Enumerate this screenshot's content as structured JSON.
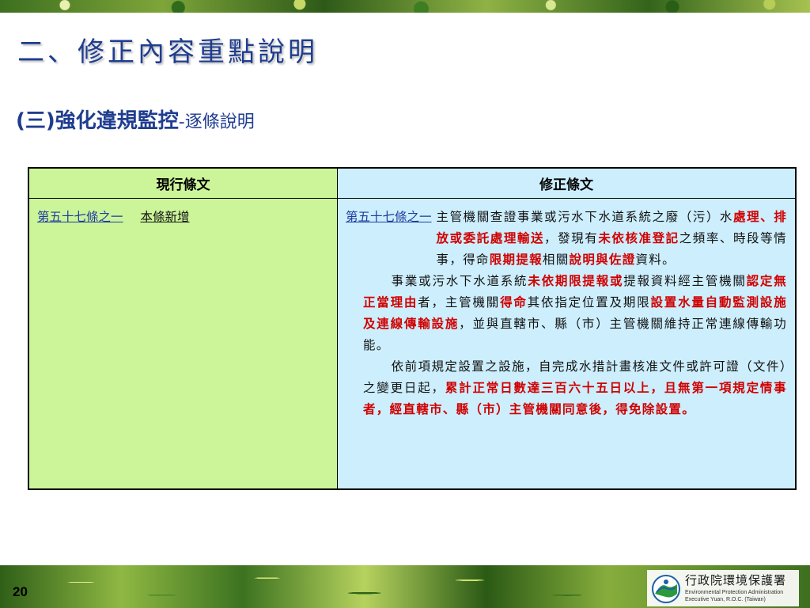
{
  "title": "二、修正內容重點說明",
  "subtitle": {
    "main": "(三)強化違規監控",
    "sub": "-逐條說明"
  },
  "table": {
    "headers": [
      "現行條文",
      "修正條文"
    ],
    "current": {
      "article": "第五十七條之一",
      "note": "本條新增"
    },
    "revised": {
      "article": "第五十七條之一",
      "p1": [
        {
          "t": "主管機關查證事業或污水下水道系統之廢（污）水",
          "b": false
        },
        {
          "t": "處理、排放或委託處理輸送",
          "b": true
        },
        {
          "t": "，發現有",
          "b": false
        },
        {
          "t": "未依核准登記",
          "b": true
        },
        {
          "t": "之頻率、時段等情事，得命",
          "b": false
        },
        {
          "t": "限期提報",
          "b": true
        },
        {
          "t": "相關",
          "b": false
        },
        {
          "t": "說明與佐證",
          "b": true
        },
        {
          "t": "資料。",
          "b": false
        }
      ],
      "p2": [
        {
          "t": "事業或污水下水道系統",
          "b": false
        },
        {
          "t": "未依期限提報或",
          "b": true
        },
        {
          "t": "提報資料經主管機關",
          "b": false
        },
        {
          "t": "認定無正當理由",
          "b": true
        },
        {
          "t": "者，主管機關",
          "b": false
        },
        {
          "t": "得命",
          "b": true
        },
        {
          "t": "其依指定位置及期限",
          "b": false
        },
        {
          "t": "設置水量自動監測設施及連線傳輸設施",
          "b": true
        },
        {
          "t": "，並與直轄市、縣（市）主管機關維持正常連線傳輸功能。",
          "b": false
        }
      ],
      "p3": [
        {
          "t": "依前項規定設置之設施，自完成水措計畫核准文件或許可證（文件）之變更日起，",
          "b": false
        },
        {
          "t": "累計正常日數達三百六十五日以上，且無第一項規定情事者，經直轄市、縣（市）主管機關同意後，得免除設置。",
          "b": true
        }
      ]
    }
  },
  "footer": {
    "page_number": "20",
    "org_zh": "行政院環境保護署",
    "org_en_1": "Environmental Protection Administration",
    "org_en_2": "Executive Yuan, R.O.C. (Taiwan)"
  },
  "colors": {
    "title": "#1f3d8f",
    "left_column_bg": "#ccf59a",
    "right_column_bg": "#cdeefc",
    "emphasis": "#d10000"
  }
}
